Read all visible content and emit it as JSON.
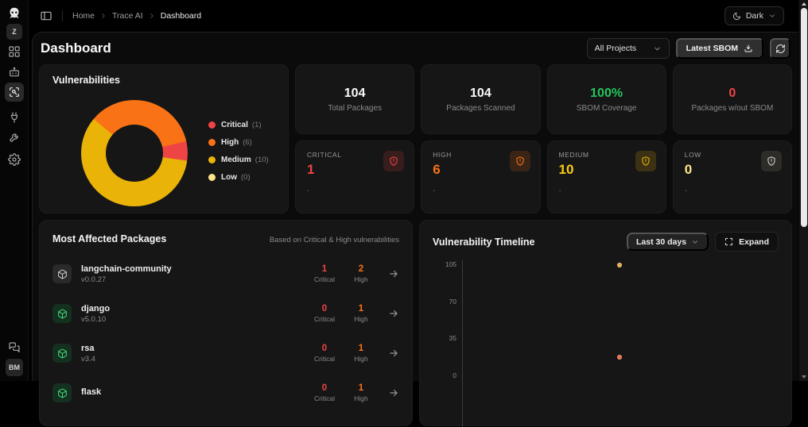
{
  "colors": {
    "critical": "#ef4444",
    "high": "#f97316",
    "medium": "#eab308",
    "low": "#fde68a",
    "success": "#22c55e",
    "background": "#000000",
    "panel": "#0b0b0b",
    "card": "#161616"
  },
  "sidebar": {
    "workspace_initial": "Z",
    "user_initials": "BM",
    "icons": [
      "logo-icon",
      "dashboard-grid-icon",
      "bot-icon",
      "scan-icon",
      "plug-icon",
      "wrench-icon",
      "settings-gear-icon",
      "chat-icon",
      "user-avatar"
    ]
  },
  "topbar": {
    "breadcrumb": [
      "Home",
      "Trace AI",
      "Dashboard"
    ],
    "theme_label": "Dark"
  },
  "header": {
    "title": "Dashboard",
    "project_filter": "All Projects",
    "sbom_button_label": "Latest SBOM"
  },
  "vulnerabilities_card": {
    "title": "Vulnerabilities",
    "legend": [
      {
        "label": "Critical",
        "count": "(1)"
      },
      {
        "label": "High",
        "count": "(6)"
      },
      {
        "label": "Medium",
        "count": "(10)"
      },
      {
        "label": "Low",
        "count": "(0)"
      }
    ]
  },
  "stat_cards": [
    {
      "value": "104",
      "label": "Total Packages"
    },
    {
      "value": "104",
      "label": "Packages Scanned"
    },
    {
      "value": "100%",
      "label": "SBOM Coverage"
    },
    {
      "value": "0",
      "label": "Packages w/out SBOM"
    }
  ],
  "severity_cards": [
    {
      "label": "CRITICAL",
      "value": "1",
      "note": "-"
    },
    {
      "label": "HIGH",
      "value": "6",
      "note": "-"
    },
    {
      "label": "MEDIUM",
      "value": "10",
      "note": "-"
    },
    {
      "label": "LOW",
      "value": "0",
      "note": "-"
    }
  ],
  "most_affected": {
    "title": "Most Affected Packages",
    "subtitle": "Based on Critical & High vulnerabilities",
    "critical_label": "Critical",
    "high_label": "High",
    "rows": [
      {
        "name": "langchain-community",
        "version": "v0.0.27",
        "critical": "1",
        "high": "2",
        "icon_tint": "gray"
      },
      {
        "name": "django",
        "version": "v5.0.10",
        "critical": "0",
        "high": "1",
        "icon_tint": "green"
      },
      {
        "name": "rsa",
        "version": "v3.4",
        "critical": "0",
        "high": "1",
        "icon_tint": "green"
      },
      {
        "name": "flask",
        "version": "",
        "critical": "0",
        "high": "1",
        "icon_tint": "green"
      }
    ]
  },
  "timeline": {
    "title": "Vulnerability Timeline",
    "range_label": "Last 30 days",
    "expand_label": "Expand"
  },
  "chart_data": [
    {
      "type": "pie",
      "donut": true,
      "title": "Vulnerabilities",
      "labels": [
        "Critical",
        "High",
        "Medium",
        "Low"
      ],
      "values": [
        1,
        6,
        10,
        0
      ],
      "colors": [
        "#ef4444",
        "#f97316",
        "#eab308",
        "#fde68a"
      ],
      "legend_position": "right",
      "render_order": [
        1,
        0,
        2,
        3
      ],
      "start_angle_deg": -50
    },
    {
      "type": "scatter",
      "title": "Vulnerability Timeline",
      "x_range_label": "Last 30 days",
      "yticks": [
        0,
        35,
        70,
        105
      ],
      "ylim": [
        0,
        112
      ],
      "grid": false,
      "x_axis_labels_visible": false,
      "points": [
        {
          "y": 104,
          "x_frac": 0.48,
          "color": "#e5a33c"
        },
        {
          "y": 17,
          "x_frac": 0.48,
          "color": "#e2603c"
        }
      ]
    }
  ]
}
